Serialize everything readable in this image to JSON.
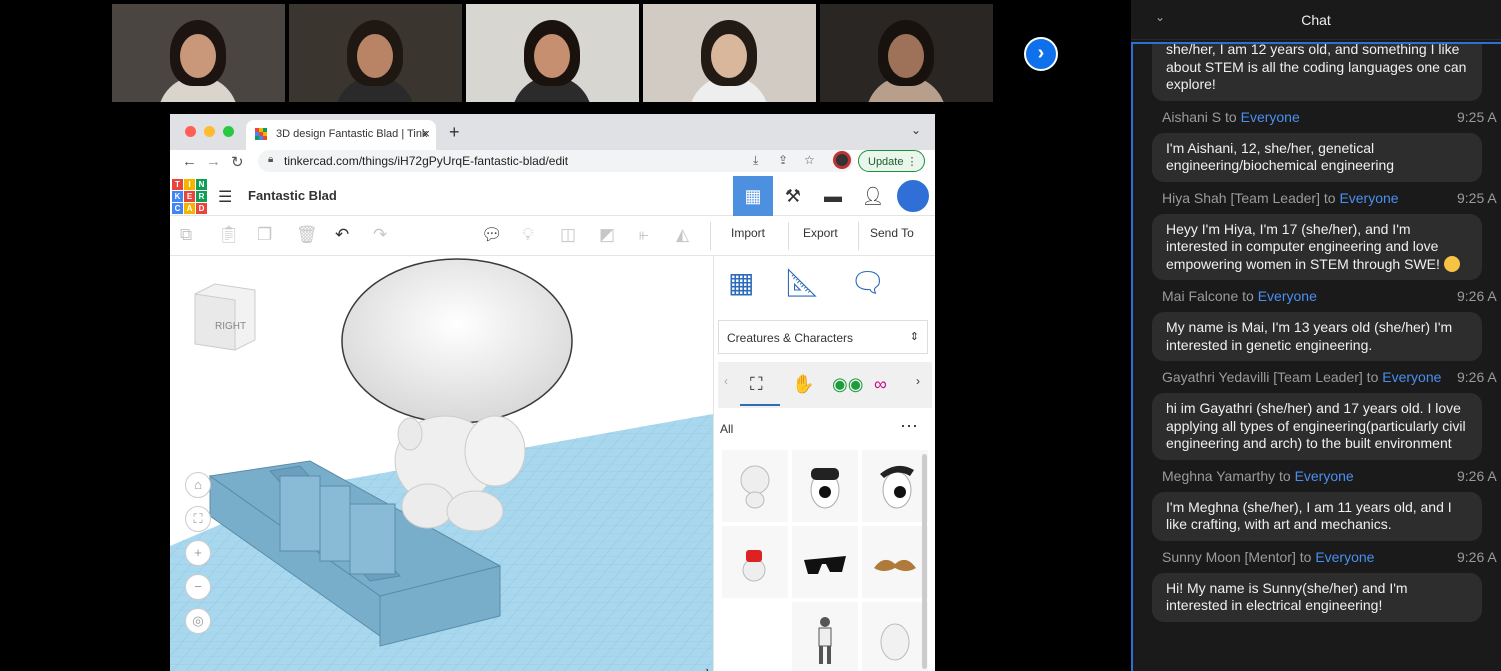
{
  "video": {
    "tiles": [
      {
        "bg": "#4a4540",
        "hair": "#1b1410",
        "skin": "#c9977a",
        "shirt": "#d9d4cc"
      },
      {
        "bg": "#3b352f",
        "hair": "#1f1712",
        "skin": "#b98466",
        "shirt": "#2a2a2a"
      },
      {
        "bg": "#d8d6d0",
        "hair": "#1a120d",
        "skin": "#c68f70",
        "shirt": "#2b2b2b"
      },
      {
        "bg": "#d1cbc3",
        "hair": "#221a15",
        "skin": "#d9b79d",
        "shirt": "#eeeeee"
      },
      {
        "bg": "#2a2624",
        "hair": "#18120e",
        "skin": "#9e7258",
        "shirt": "#b89f8c"
      }
    ],
    "next_icon": "›"
  },
  "browser": {
    "tab_title": "3D design Fantastic Blad | Tink",
    "tab_close": "×",
    "new_tab": "+",
    "url": "tinkercad.com/things/iH72gPyUrqE-fantastic-blad/edit",
    "update_label": "Update"
  },
  "tinkercad": {
    "logo_letters": [
      "T",
      "I",
      "N",
      "K",
      "E",
      "R",
      "C",
      "A",
      "D"
    ],
    "design_title": "Fantastic Blad",
    "toolbar": {
      "import_label": "Import",
      "export_label": "Export",
      "send_to_label": "Send To"
    },
    "view_cube_label": "RIGHT",
    "panel": {
      "category": "Creatures & Characters",
      "filter": "All"
    }
  },
  "chat": {
    "title": "Chat",
    "messages": [
      {
        "sender": "",
        "to": "",
        "time": "",
        "text": "she/her, I am 12 years old, and something I like about STEM is all the coding languages one can explore!"
      },
      {
        "sender": "Aishani S to ",
        "to": "Everyone",
        "time": "9:25 A",
        "text": "I'm Aishani, 12, she/her, genetical engineering/biochemical engineering"
      },
      {
        "sender": "Hiya Shah [Team Leader] to ",
        "to": "Everyone",
        "time": "9:25 A",
        "text": "Heyy I'm Hiya, I'm 17 (she/her), and I'm interested in computer engineering and love empowering women in STEM through SWE!"
      },
      {
        "sender": "Mai Falcone to ",
        "to": "Everyone",
        "time": "9:26 A",
        "text": "My name is Mai, I'm 13 years old (she/her) I'm interested in genetic engineering."
      },
      {
        "sender": "Gayathri Yedavilli [Team Leader] to ",
        "to": "Everyone",
        "time": "9:26 A",
        "text": "hi im Gayathri (she/her) and 17 years old. I love applying all types of engineering(particularly civil engineering and arch) to the built environment"
      },
      {
        "sender": "Meghna Yamarthy to ",
        "to": "Everyone",
        "time": "9:26 A",
        "text": "I'm Meghna (she/her), I am 11 years old, and I like crafting, with art and mechanics."
      },
      {
        "sender": "Sunny Moon [Mentor] to ",
        "to": "Everyone",
        "time": "9:26 A",
        "text": "Hi! My name is Sunny(she/her) and I'm interested in electrical engineering!"
      }
    ]
  },
  "colors": {
    "zoom_blue": "#0e71eb",
    "tinker_blue": "#4d90e0",
    "workplane": "#a9d8ee",
    "model_blue": "#79aecb",
    "everyone_blue": "#4a8ff0"
  }
}
